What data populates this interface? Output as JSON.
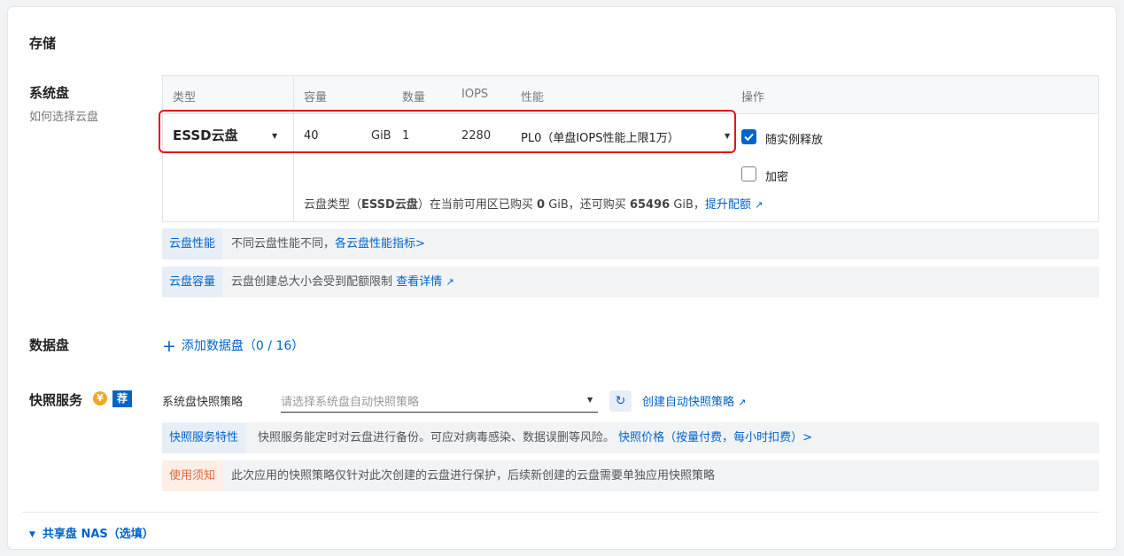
{
  "storage": {
    "title": "存储",
    "system_disk": {
      "title": "系统盘",
      "help_link": "如何选择云盘",
      "headers": {
        "type": "类型",
        "capacity": "容量",
        "count": "数量",
        "iops": "IOPS",
        "performance": "性能",
        "actions": "操作"
      },
      "row": {
        "type": "ESSD云盘",
        "capacity": "40",
        "unit": "GiB",
        "count": "1",
        "iops": "2280",
        "performance": "PL0（单盘IOPS性能上限1万）",
        "release_with_instance": "随实例释放",
        "release_checked": true,
        "encrypt": "加密",
        "encrypt_checked": false
      },
      "quota": {
        "pre": "云盘类型（",
        "type": "ESSD云盘",
        "mid1": "）在当前可用区已购买",
        "bought": "0",
        "mid2": "GiB，还可购买",
        "remaining": "65496",
        "mid3": "GiB，",
        "link": "提升配额"
      },
      "perf_tag": "云盘性能",
      "perf_text": "不同云盘性能不同，",
      "perf_link": "各云盘性能指标>",
      "cap_tag": "云盘容量",
      "cap_text": "云盘创建总大小会受到配额限制",
      "cap_link": "查看详情"
    },
    "data_disk": {
      "title": "数据盘",
      "add_label": "添加数据盘（0 / 16）"
    },
    "snapshot": {
      "title": "快照服务",
      "badge_yen": "¥",
      "badge_rec": "荐",
      "policy_label": "系统盘快照策略",
      "policy_placeholder": "请选择系统盘自动快照策略",
      "create_link": "创建自动快照策略",
      "feature_tag": "快照服务特性",
      "feature_text": "快照服务能定时对云盘进行备份。可应对病毒感染、数据误删等风险。",
      "feature_link": "快照价格（按量付费，每小时扣费）>",
      "notice_tag": "使用须知",
      "notice_text": "此次应用的快照策略仅针对此次创建的云盘进行保护，后续新创建的云盘需要单独应用快照策略"
    },
    "shared": {
      "label": "共享盘 NAS（选填）"
    }
  },
  "colors": {
    "primary": "#0064c8",
    "highlight": "#e0141e",
    "warning": "#e0693a",
    "badge": "#f5a623"
  }
}
